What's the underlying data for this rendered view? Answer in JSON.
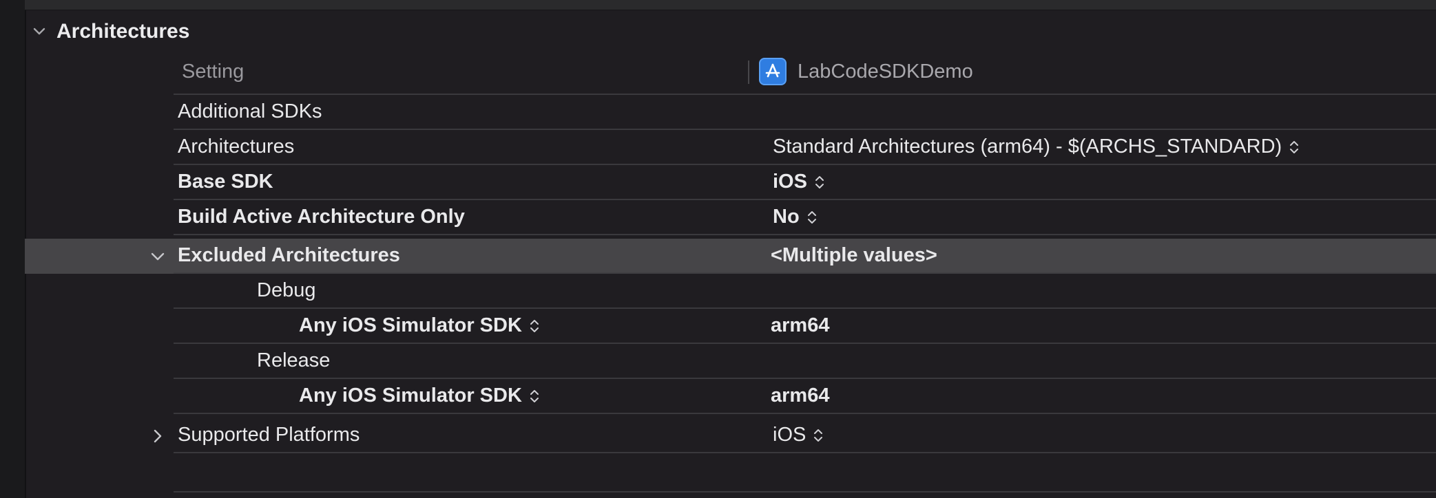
{
  "section": {
    "title": "Architectures"
  },
  "header": {
    "setting_label": "Setting",
    "target_name": "LabCodeSDKDemo"
  },
  "rows": {
    "additional_sdks": {
      "label": "Additional SDKs",
      "value": ""
    },
    "architectures": {
      "label": "Architectures",
      "value": "Standard Architectures (arm64)  -  $(ARCHS_STANDARD)"
    },
    "base_sdk": {
      "label": "Base SDK",
      "value": "iOS"
    },
    "build_active_arch": {
      "label": "Build Active Architecture Only",
      "value": "No"
    },
    "excluded_archs": {
      "label": "Excluded Architectures",
      "value": "<Multiple values>"
    },
    "debug": {
      "label": "Debug"
    },
    "debug_sdk": {
      "label": "Any iOS Simulator SDK",
      "value": "arm64"
    },
    "release": {
      "label": "Release"
    },
    "release_sdk": {
      "label": "Any iOS Simulator SDK",
      "value": "arm64"
    },
    "supported_platforms": {
      "label": "Supported Platforms",
      "value": "iOS"
    }
  },
  "colors": {
    "background": "#1f1d21",
    "selected_row": "#464548",
    "divider": "#3a393d",
    "accent": "#2f7de1"
  },
  "icons": {
    "section_chevron": "chevron-down-icon",
    "app_icon": "app-store-icon",
    "stepper": "up-down-stepper-icon",
    "row_expand": "chevron-right-icon",
    "row_collapse": "chevron-down-icon"
  }
}
